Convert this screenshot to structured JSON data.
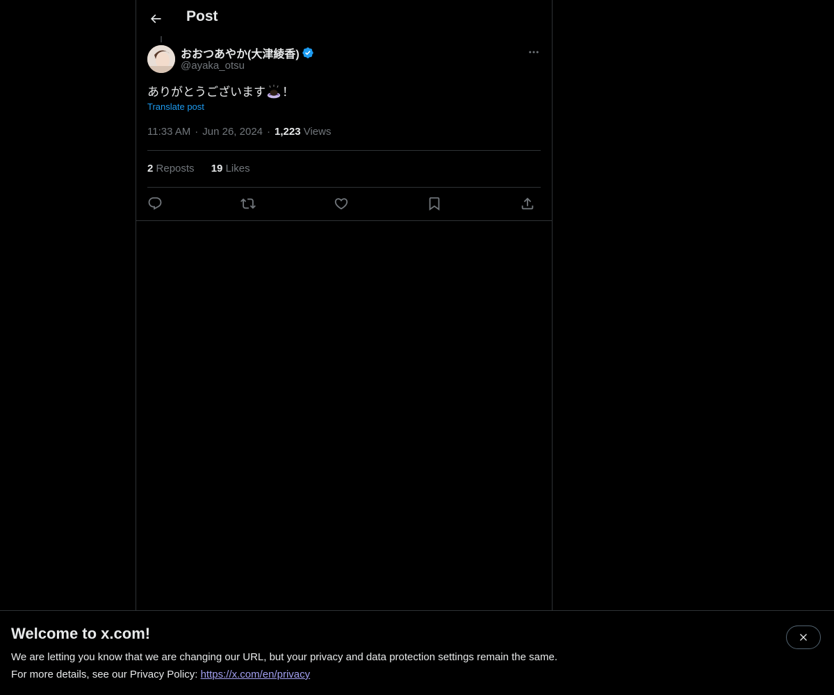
{
  "header": {
    "title": "Post",
    "back_icon": "arrow-left-icon"
  },
  "post": {
    "author": {
      "name": "おおつあやか(大津綾香)",
      "handle": "@ayaka_otsu",
      "verified": true
    },
    "text_before_emoji": "ありがとうございます",
    "emoji": "bowing-person-emoji",
    "text_after_emoji": "！",
    "translate_label": "Translate post",
    "time": "11:33 AM",
    "date": "Jun 26, 2024",
    "views_count": "1,223",
    "views_label": "Views",
    "reposts_count": "2",
    "reposts_label": "Reposts",
    "likes_count": "19",
    "likes_label": "Likes",
    "separator": "·"
  },
  "actions": [
    "reply-icon",
    "repost-icon",
    "like-icon",
    "bookmark-icon",
    "share-icon"
  ],
  "banner": {
    "title": "Welcome to x.com!",
    "line1": "We are letting you know that we are changing our URL, but your privacy and data protection settings remain the same.",
    "line2_prefix": "For more details, see our Privacy Policy: ",
    "link": "https://x.com/en/privacy"
  },
  "colors": {
    "background": "#000000",
    "text_primary": "#e7e9ea",
    "text_secondary": "#71767b",
    "accent": "#1d9bf0",
    "border": "#2f3336",
    "link": "#a29ff0"
  }
}
